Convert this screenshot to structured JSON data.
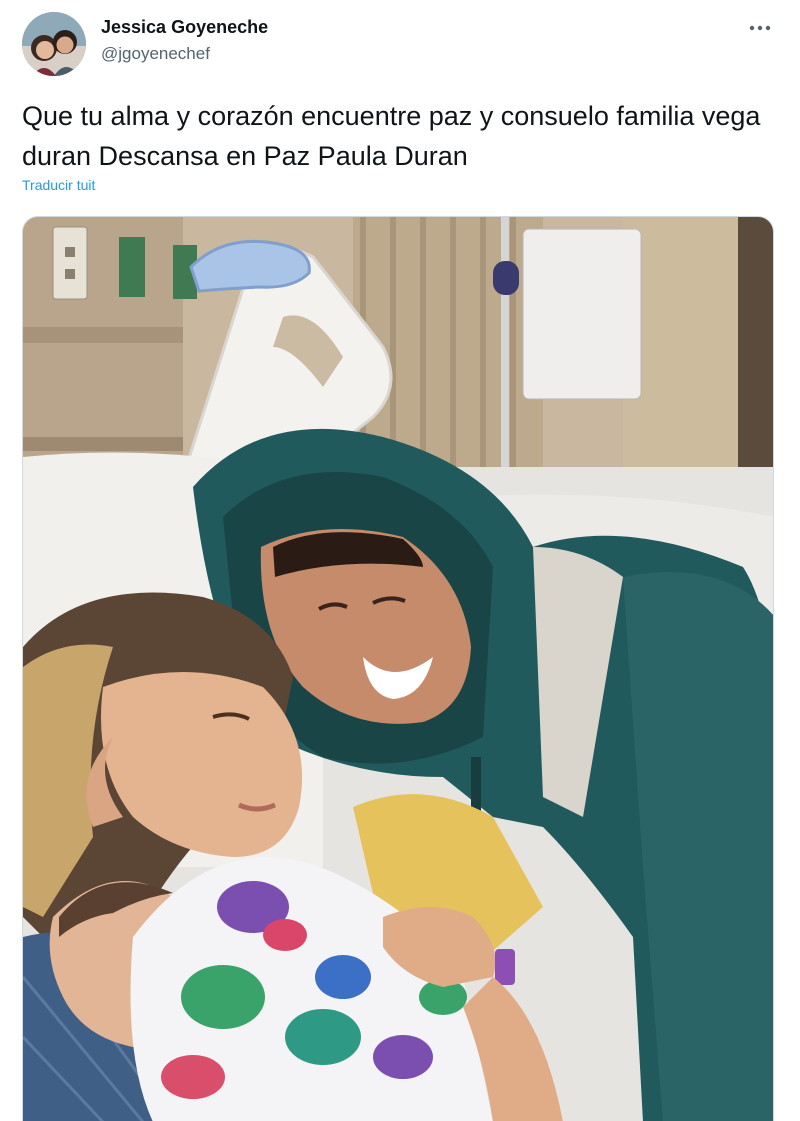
{
  "tweet": {
    "author": {
      "display_name": "Jessica Goyeneche",
      "handle": "@jgoyenechef",
      "avatar_icon": "profile-photo-couple"
    },
    "more_icon": "more-horizontal-icon",
    "text": "Que tu alma y corazón encuentre paz y consuelo familia vega duran Descansa en Paz Paula Duran",
    "translate_label": "Traducir tuit",
    "media": {
      "kind": "photo",
      "subject": "hospital-room-family-photo"
    }
  },
  "colors": {
    "text_primary": "#0f1419",
    "text_secondary": "#536471",
    "link": "#1d9bf0",
    "border": "#cfd9de"
  }
}
